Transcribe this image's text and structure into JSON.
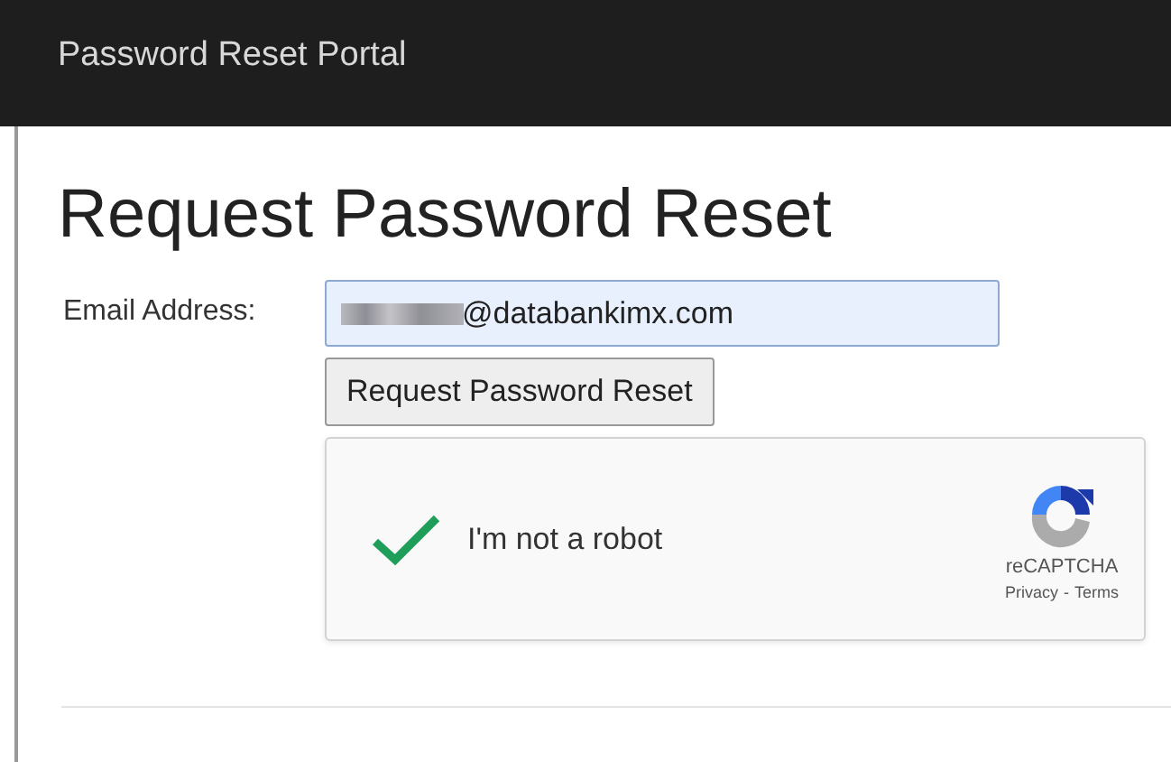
{
  "header": {
    "title": "Password Reset Portal"
  },
  "page": {
    "heading": "Request Password Reset"
  },
  "form": {
    "email_label": "Email Address:",
    "email_value": "@databankimx.com",
    "submit": "Request Password Reset"
  },
  "captcha": {
    "label": "I'm not a robot",
    "checked": true,
    "brand": "reCAPTCHA",
    "privacy": "Privacy",
    "separator": "-",
    "terms": "Terms"
  }
}
